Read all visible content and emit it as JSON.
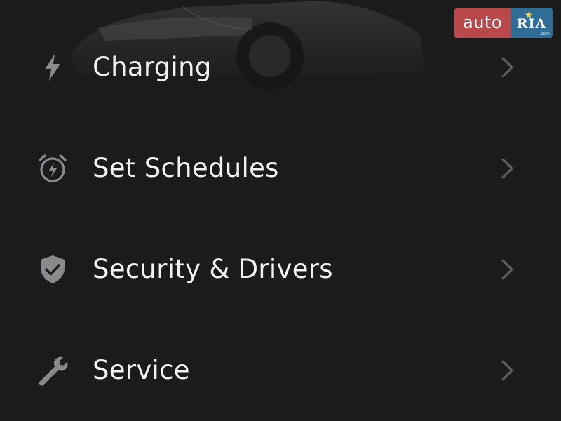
{
  "watermark": {
    "left_text": "auto",
    "right_text": "RIA",
    "domain_text": ".com"
  },
  "menu": {
    "items": [
      {
        "label": "Charging",
        "icon": "lightning-bolt-icon"
      },
      {
        "label": "Set Schedules",
        "icon": "alarm-clock-icon"
      },
      {
        "label": "Security & Drivers",
        "icon": "shield-check-icon"
      },
      {
        "label": "Service",
        "icon": "wrench-icon"
      }
    ]
  },
  "colors": {
    "background": "#1b1b1c",
    "label": "#f2f2f2",
    "icon": "#8a8a8c",
    "chevron": "#5d5d60",
    "watermark_red": "#b9484a",
    "watermark_blue": "#2f6d96"
  }
}
